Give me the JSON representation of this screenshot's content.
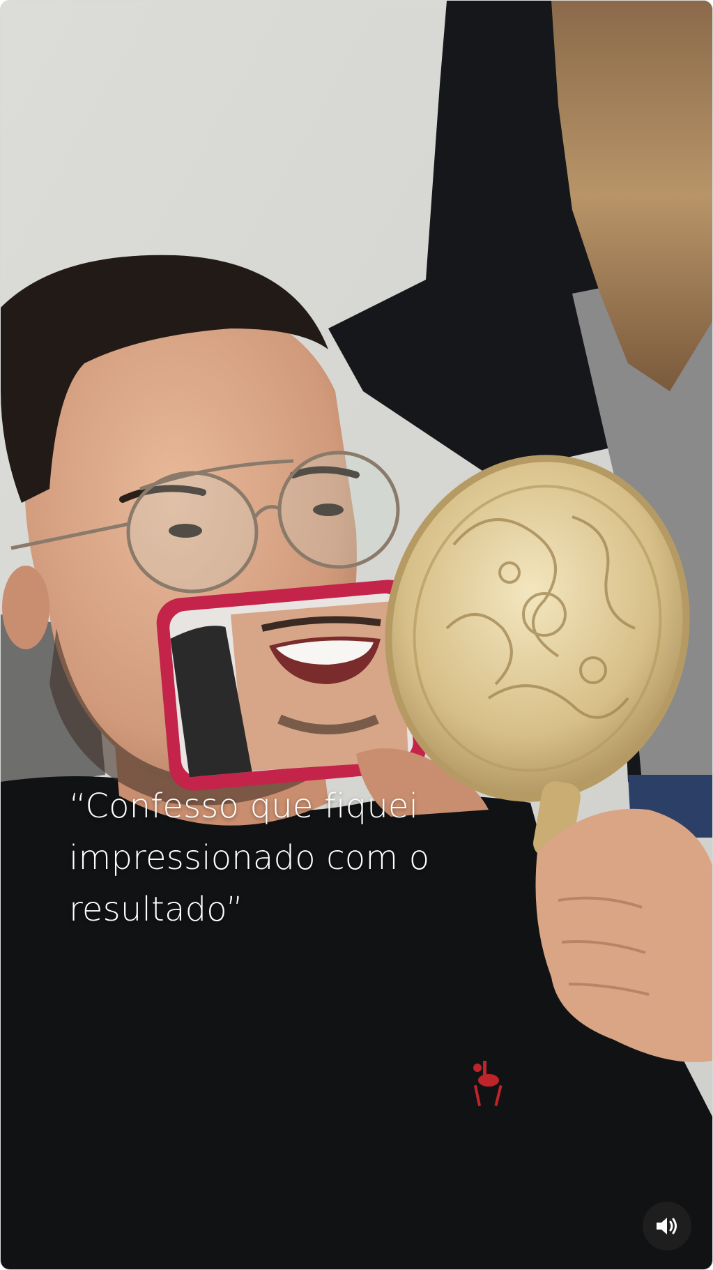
{
  "video": {
    "caption": "“Confesso que fiquei impressionado com o resultado”",
    "sound_icon": "speaker-volume-icon"
  },
  "colors": {
    "wall": "#d6d6d2",
    "shirt": "#111214",
    "jacket": "#15171b",
    "phone_case": "#c4234a",
    "mirror_gold": "#d8c08a",
    "logo_red": "#c0242b",
    "sound_button_bg": "#1e1e1e"
  }
}
